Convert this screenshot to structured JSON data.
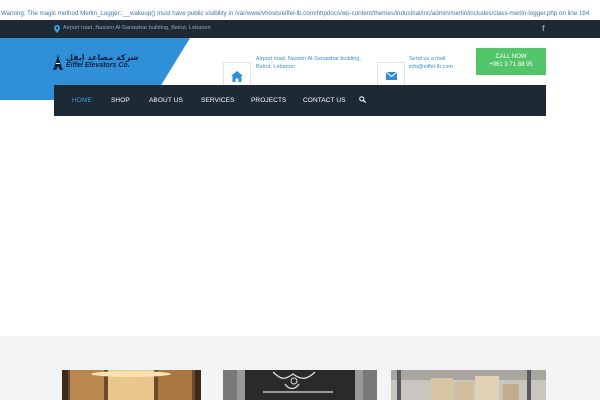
{
  "warning": "Warning: The magic method Merlin_Logger::__wakeup() must have public visibility in /var/www/vhosts/eiffel-lb.com/httpdocs/wp-content/themes/industrial/inc/admin/merlin/includes/class-merlin-logger.php on line 194",
  "topbar": {
    "address": "Airport road, Nassim Al-Sanawbar building, Beirut, Lebanon",
    "social_icon": "facebook-icon"
  },
  "logo": {
    "arabic": "شركة مصاعد ايفل",
    "english": "Eiffel Elevators Co."
  },
  "header": {
    "address_lines": [
      "Airport road, Nassim Al-Sanawbar building,",
      "Beirut, Lebanon"
    ],
    "mail_lines": [
      "Send us a mail",
      "info@eiffel-lb.com"
    ],
    "home_icon": "home-icon",
    "mail_icon": "envelope-icon"
  },
  "cta": {
    "label": "CALL NOW",
    "phone": "+961 3 71 88 95"
  },
  "nav": {
    "items": [
      "HOME",
      "SHOP",
      "ABOUT US",
      "SERVICES",
      "PROJECTS",
      "CONTACT US"
    ],
    "active": "HOME",
    "search_icon": "search-icon"
  },
  "colors": {
    "dark": "#1d2a35",
    "accent_blue": "#2f8fd8",
    "green": "#53c46a"
  }
}
